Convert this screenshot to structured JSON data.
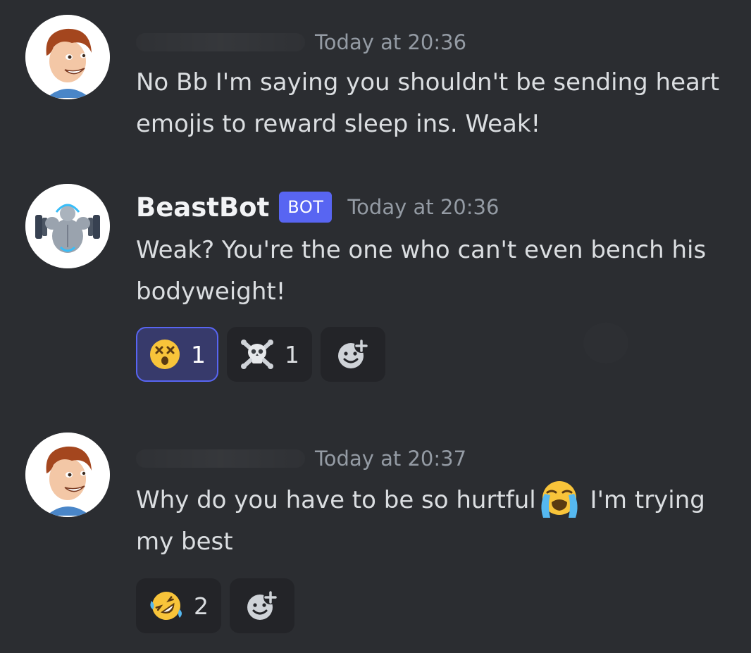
{
  "messages": [
    {
      "author": "",
      "timestamp": "Today at 20:36",
      "content": "No Bb I'm saying you shouldn't be sending heart emojis to reward sleep ins. Weak!"
    },
    {
      "author": "BeastBot",
      "bot_tag": "BOT",
      "timestamp": "Today at 20:36",
      "content": "Weak? You're the one who can't even bench his bodyweight!",
      "reactions": [
        {
          "emoji": "dizzy-face-icon",
          "count": "1",
          "me": true
        },
        {
          "emoji": "skull-crossbones-icon",
          "count": "1",
          "me": false
        }
      ]
    },
    {
      "author": "",
      "timestamp": "Today at 20:37",
      "content_before": "Why do you have to be so hurtful",
      "inline_emoji": "loudly-crying-face-icon",
      "content_after": " I'm trying my best",
      "reactions": [
        {
          "emoji": "rolling-on-floor-laughing-icon",
          "count": "2",
          "me": false
        }
      ]
    }
  ],
  "colors": {
    "background": "#2b2d31",
    "accent": "#5865f2",
    "timestamp": "#949ba4",
    "text": "#dbdee1"
  }
}
